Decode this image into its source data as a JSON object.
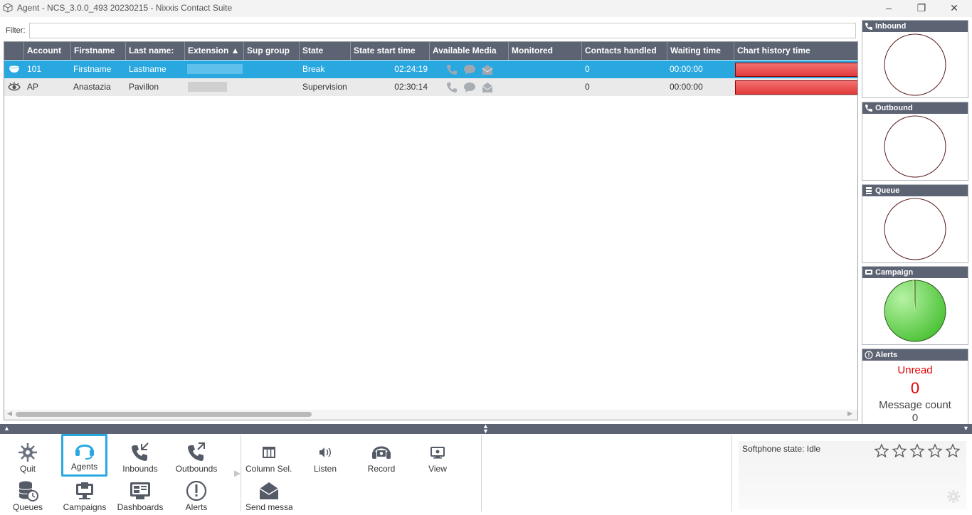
{
  "window": {
    "title": "Agent - NCS_3.0.0_493 20230215 - Nixxis Contact Suite",
    "minimize": "–",
    "maximize": "❐",
    "close": "✕"
  },
  "filter": {
    "label": "Filter:",
    "value": "",
    "placeholder": ""
  },
  "grid": {
    "columns": [
      "Account",
      "Firstname",
      "Last name:",
      "Extension ▲",
      "Sup group",
      "State",
      "State start time",
      "Available Media",
      "Monitored",
      "Contacts handled",
      "Waiting time",
      "Chart history time"
    ],
    "rows": [
      {
        "icon": "coffee-cup-icon",
        "account": "101",
        "firstname": "Firstname",
        "lastname": "Lastname",
        "sup_group": "",
        "state": "Break",
        "state_start_time": "02:24:19",
        "monitored": "",
        "contacts_handled": "0",
        "waiting_time": "00:00:00",
        "selected": true
      },
      {
        "icon": "eye-icon",
        "account": "AP",
        "firstname": "Anastazia",
        "lastname": "Pavillon",
        "sup_group": "",
        "state": "Supervision",
        "state_start_time": "02:30:14",
        "monitored": "",
        "contacts_handled": "0",
        "waiting_time": "00:00:00",
        "selected": false
      }
    ]
  },
  "panels": {
    "inbound": {
      "title": "Inbound"
    },
    "outbound": {
      "title": "Outbound"
    },
    "queue": {
      "title": "Queue"
    },
    "campaign": {
      "title": "Campaign"
    },
    "alerts": {
      "title": "Alerts",
      "unread_label": "Unread",
      "unread_count": "0",
      "message_label": "Message count",
      "message_count": "0"
    }
  },
  "toolbar": {
    "quit": "Quit",
    "agents": "Agents",
    "inbounds": "Inbounds",
    "outbounds": "Outbounds",
    "queues": "Queues",
    "campaigns": "Campaigns",
    "dashboards": "Dashboards",
    "alerts": "Alerts",
    "column_sel": "Column Sel...",
    "listen": "Listen",
    "record": "Record",
    "view": "View",
    "send_message": "Send messa..."
  },
  "softphone": {
    "state": "Softphone state: Idle",
    "rating_stars": 5
  },
  "colors": {
    "header": "#5c6373",
    "selection": "#29a8e0",
    "chart_bar": "#e03b3b",
    "campaign_pie": "#6fd85a",
    "alert_red": "#e00000"
  }
}
